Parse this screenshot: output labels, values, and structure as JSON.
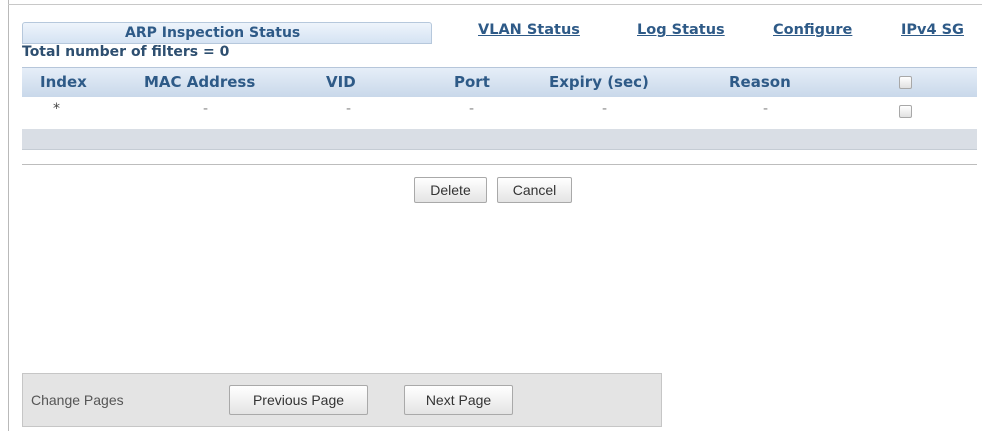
{
  "tabs": {
    "active": "ARP Inspection Status",
    "links": [
      "VLAN Status",
      "Log Status",
      "Configure",
      "IPv4 SG"
    ]
  },
  "filters_text": "Total number of filters = 0",
  "table": {
    "columns": [
      "Index",
      "MAC Address",
      "VID",
      "Port",
      "Expiry (sec)",
      "Reason"
    ],
    "rows": [
      [
        "*",
        "-",
        "-",
        "-",
        "-",
        "-"
      ]
    ]
  },
  "actions": {
    "delete": "Delete",
    "cancel": "Cancel"
  },
  "pager": {
    "label": "Change Pages",
    "previous": "Previous Page",
    "next": "Next Page"
  }
}
